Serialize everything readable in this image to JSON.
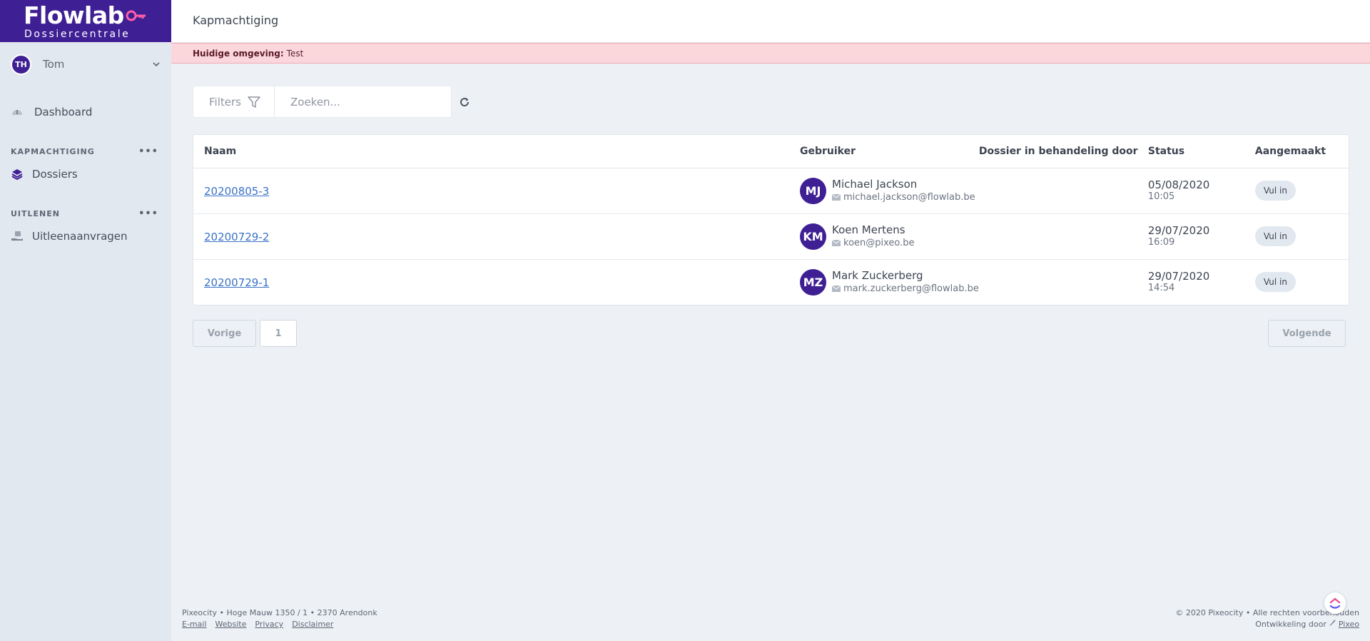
{
  "app": {
    "logo_title": "Flowlab",
    "logo_subtitle": "Dossiercentrale"
  },
  "sidebar": {
    "user": {
      "initials": "TH",
      "name": "Tom"
    },
    "dashboard_label": "Dashboard",
    "sections": [
      {
        "title": "KAPMACHTIGING",
        "items": [
          {
            "label": "Dossiers",
            "icon": "layers-icon"
          }
        ]
      },
      {
        "title": "UITLENEN",
        "items": [
          {
            "label": "Uitleenaanvragen",
            "icon": "hand-box-icon"
          }
        ]
      }
    ]
  },
  "header": {
    "title": "Kapmachtiging"
  },
  "environment": {
    "label": "Huidige omgeving:",
    "value": "Test"
  },
  "toolbar": {
    "filters_label": "Filters",
    "search_placeholder": "Zoeken..."
  },
  "table": {
    "columns": [
      "Naam",
      "Gebruiker",
      "Dossier in behandeling door",
      "Status",
      "Aangemaakt"
    ],
    "rows": [
      {
        "naam": "20200805-3",
        "initials": "MJ",
        "user_name": "Michael Jackson",
        "user_email": "michael.jackson@flowlab.be",
        "handler": "",
        "date": "05/08/2020",
        "time": "10:05",
        "action": "Vul in"
      },
      {
        "naam": "20200729-2",
        "initials": "KM",
        "user_name": "Koen Mertens",
        "user_email": "koen@pixeo.be",
        "handler": "",
        "date": "29/07/2020",
        "time": "16:09",
        "action": "Vul in"
      },
      {
        "naam": "20200729-1",
        "initials": "MZ",
        "user_name": "Mark Zuckerberg",
        "user_email": "mark.zuckerberg@flowlab.be",
        "handler": "",
        "date": "29/07/2020",
        "time": "14:54",
        "action": "Vul in"
      }
    ]
  },
  "pagination": {
    "prev_label": "Vorige",
    "current_page": "1",
    "next_label": "Volgende"
  },
  "footer": {
    "address": "Pixeocity • Hoge Mauw 1350 / 1 • 2370 Arendonk",
    "links": [
      "E-mail",
      "Website",
      "Privacy",
      "Disclaimer"
    ],
    "copyright": "© 2020 Pixeocity • Alle rechten voorbehouden",
    "dev_prefix": "Ontwikkeling door",
    "dev_name": "Pixeo"
  },
  "colors": {
    "brand": "#3f1f94",
    "link": "#3a72c7",
    "env_bg": "#fbd7dc"
  }
}
